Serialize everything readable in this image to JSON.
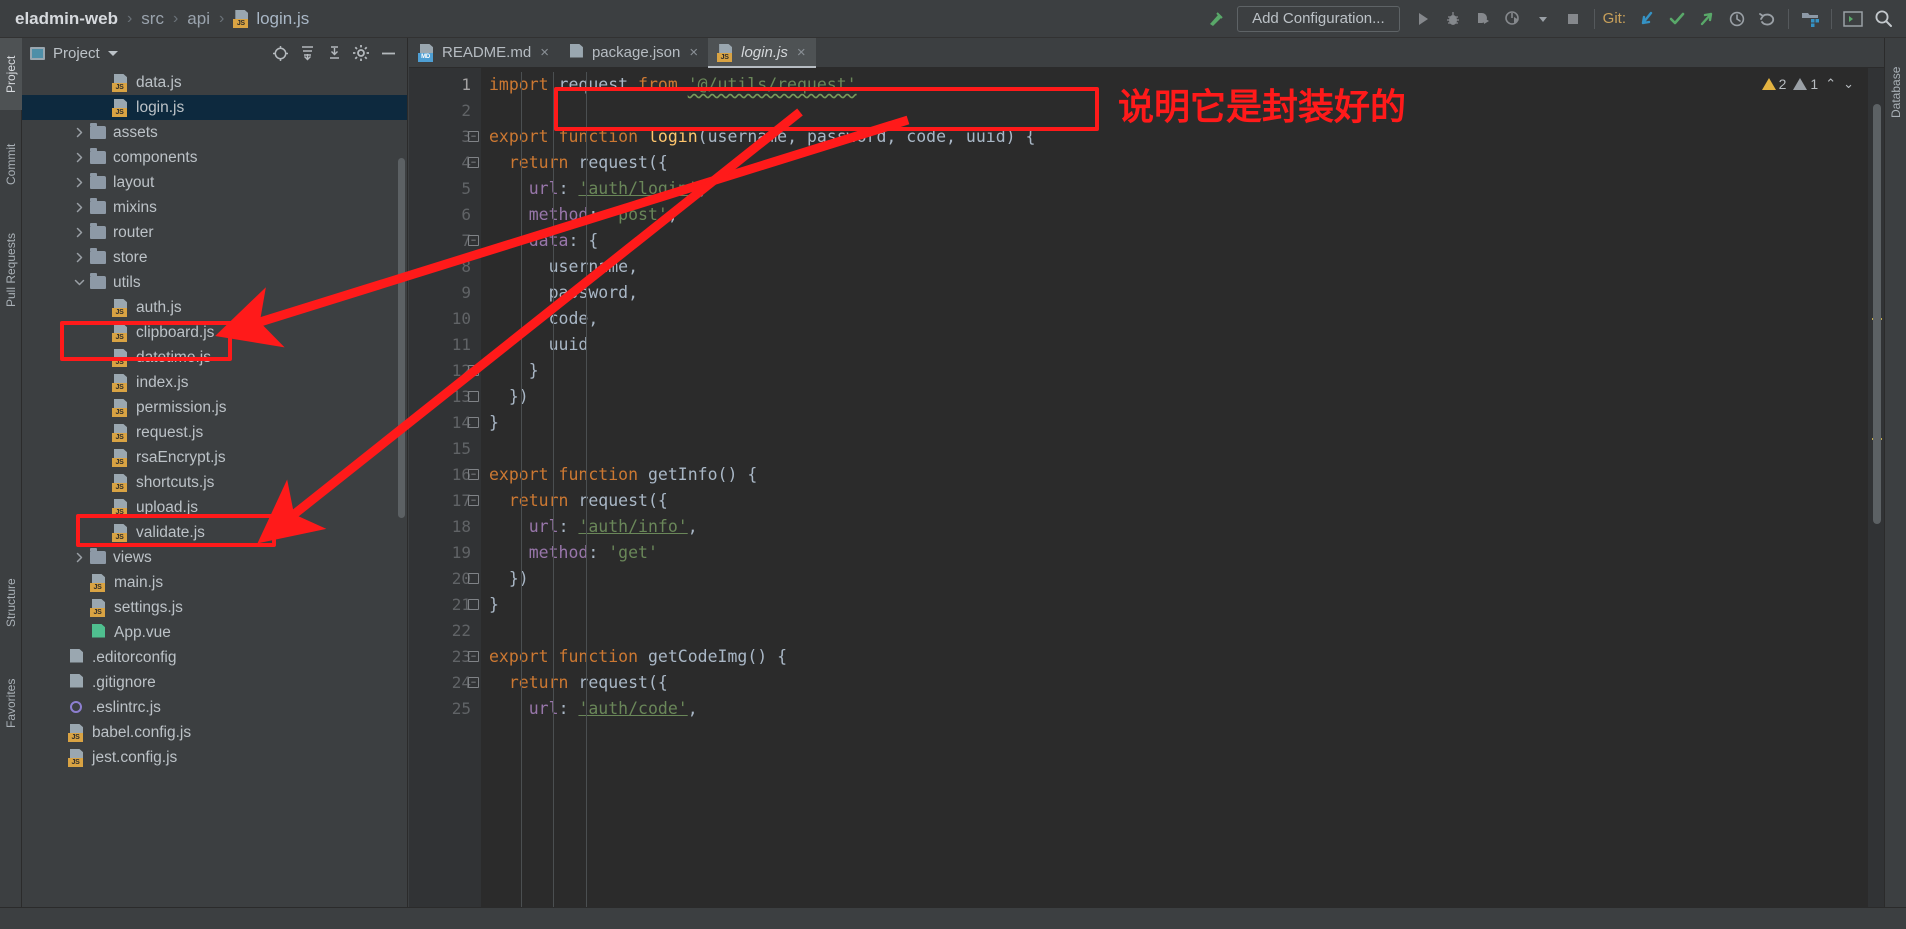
{
  "window": {
    "breadcrumb": [
      {
        "label": "eladmin-web",
        "type": "project"
      },
      {
        "label": "src",
        "type": "dir"
      },
      {
        "label": "api",
        "type": "dir"
      },
      {
        "label": "login.js",
        "type": "file"
      }
    ],
    "separator": "›"
  },
  "toolbar": {
    "add_configuration": "Add Configuration...",
    "git_label": "Git:",
    "icons": {
      "build": "hammer-icon",
      "run": "run-icon",
      "debug": "debug-icon",
      "run_coverage": "run-with-coverage-icon",
      "profile": "profiler-icon",
      "dropdown": "chevron-down-icon",
      "stop": "stop-icon",
      "git_update": "git-update-icon",
      "git_commit": "git-commit-icon",
      "git_push": "git-push-icon",
      "git_history": "git-history-icon",
      "git_rollback": "git-rollback-icon",
      "project_structure": "project-structure-icon",
      "terminal": "terminal-icon",
      "search": "search-icon"
    },
    "colors": {
      "git_update": "#3592c4",
      "git_commit": "#59a869",
      "git_push": "#59a869",
      "hammer": "#59a869"
    }
  },
  "left_tool_strip": [
    {
      "label": "Project",
      "selected": true
    },
    {
      "label": "Commit",
      "selected": false
    },
    {
      "label": "Pull Requests",
      "selected": false
    },
    {
      "label": "Structure",
      "selected": false
    },
    {
      "label": "Favorites",
      "selected": false
    }
  ],
  "right_tool_strip": [
    {
      "label": "Database",
      "selected": false
    }
  ],
  "project_panel": {
    "title": "Project",
    "actions": [
      {
        "name": "select-opened-file-icon"
      },
      {
        "name": "expand-all-icon"
      },
      {
        "name": "collapse-all-icon"
      },
      {
        "name": "settings-gear-icon"
      },
      {
        "name": "hide-icon"
      }
    ],
    "tree": [
      {
        "label": "data.js",
        "indent": 3,
        "icon": "js",
        "arrow": "none",
        "selected": false
      },
      {
        "label": "login.js",
        "indent": 3,
        "icon": "js",
        "arrow": "none",
        "selected": true
      },
      {
        "label": "assets",
        "indent": 2,
        "icon": "folder",
        "arrow": "collapsed",
        "selected": false
      },
      {
        "label": "components",
        "indent": 2,
        "icon": "folder",
        "arrow": "collapsed",
        "selected": false
      },
      {
        "label": "layout",
        "indent": 2,
        "icon": "folder",
        "arrow": "collapsed",
        "selected": false
      },
      {
        "label": "mixins",
        "indent": 2,
        "icon": "folder",
        "arrow": "collapsed",
        "selected": false
      },
      {
        "label": "router",
        "indent": 2,
        "icon": "folder",
        "arrow": "collapsed",
        "selected": false
      },
      {
        "label": "store",
        "indent": 2,
        "icon": "folder",
        "arrow": "collapsed",
        "selected": false
      },
      {
        "label": "utils",
        "indent": 2,
        "icon": "folder",
        "arrow": "expanded",
        "selected": false
      },
      {
        "label": "auth.js",
        "indent": 3,
        "icon": "js",
        "arrow": "none",
        "selected": false
      },
      {
        "label": "clipboard.js",
        "indent": 3,
        "icon": "js",
        "arrow": "none",
        "selected": false
      },
      {
        "label": "datetime.js",
        "indent": 3,
        "icon": "js",
        "arrow": "none",
        "selected": false
      },
      {
        "label": "index.js",
        "indent": 3,
        "icon": "js",
        "arrow": "none",
        "selected": false
      },
      {
        "label": "permission.js",
        "indent": 3,
        "icon": "js",
        "arrow": "none",
        "selected": false
      },
      {
        "label": "request.js",
        "indent": 3,
        "icon": "js",
        "arrow": "none",
        "selected": false
      },
      {
        "label": "rsaEncrypt.js",
        "indent": 3,
        "icon": "js",
        "arrow": "none",
        "selected": false
      },
      {
        "label": "shortcuts.js",
        "indent": 3,
        "icon": "js",
        "arrow": "none",
        "selected": false
      },
      {
        "label": "upload.js",
        "indent": 3,
        "icon": "js",
        "arrow": "none",
        "selected": false
      },
      {
        "label": "validate.js",
        "indent": 3,
        "icon": "js",
        "arrow": "none",
        "selected": false
      },
      {
        "label": "views",
        "indent": 2,
        "icon": "folder",
        "arrow": "collapsed",
        "selected": false
      },
      {
        "label": "main.js",
        "indent": 2,
        "icon": "js",
        "arrow": "none",
        "selected": false
      },
      {
        "label": "settings.js",
        "indent": 2,
        "icon": "js",
        "arrow": "none",
        "selected": false
      },
      {
        "label": "App.vue",
        "indent": 2,
        "icon": "vue",
        "arrow": "none",
        "selected": false
      },
      {
        "label": ".editorconfig",
        "indent": 1,
        "icon": "cfg",
        "arrow": "none",
        "selected": false
      },
      {
        "label": ".gitignore",
        "indent": 1,
        "icon": "git",
        "arrow": "none",
        "selected": false
      },
      {
        "label": ".eslintrc.js",
        "indent": 1,
        "icon": "eslint",
        "arrow": "none",
        "selected": false
      },
      {
        "label": "babel.config.js",
        "indent": 1,
        "icon": "js",
        "arrow": "none",
        "selected": false
      },
      {
        "label": "jest.config.js",
        "indent": 1,
        "icon": "js",
        "arrow": "none",
        "selected": false
      }
    ]
  },
  "editor": {
    "tabs": [
      {
        "label": "README.md",
        "icon": "md",
        "active": false,
        "close": "×"
      },
      {
        "label": "package.json",
        "icon": "json",
        "active": false,
        "close": "×"
      },
      {
        "label": "login.js",
        "icon": "js",
        "active": true,
        "close": "×"
      }
    ],
    "inspection": {
      "warning_count": "2",
      "weak_warning_count": "1",
      "up_chevron": "⌃",
      "down_chevron": "⌄"
    },
    "lines": [
      {
        "n": "1",
        "fold": "none",
        "tokens": [
          {
            "t": "import",
            "c": "kw"
          },
          {
            "t": " ",
            "c": "pun"
          },
          {
            "t": "request",
            "c": "idn"
          },
          {
            "t": " ",
            "c": "pun"
          },
          {
            "t": "from",
            "c": "kw"
          },
          {
            "t": " ",
            "c": "pun"
          },
          {
            "t": "'@/utils/request'",
            "c": "wavy-str"
          }
        ]
      },
      {
        "n": "2",
        "fold": "none",
        "tokens": []
      },
      {
        "n": "3",
        "fold": "open",
        "tokens": [
          {
            "t": "export",
            "c": "kw"
          },
          {
            "t": " ",
            "c": "pun"
          },
          {
            "t": "function",
            "c": "kw"
          },
          {
            "t": " ",
            "c": "pun"
          },
          {
            "t": "login",
            "c": "fn"
          },
          {
            "t": "(",
            "c": "pun"
          },
          {
            "t": "username",
            "c": "idn"
          },
          {
            "t": ", ",
            "c": "pun"
          },
          {
            "t": "password",
            "c": "idn"
          },
          {
            "t": ", ",
            "c": "pun"
          },
          {
            "t": "code",
            "c": "idn"
          },
          {
            "t": ", ",
            "c": "pun"
          },
          {
            "t": "uuid",
            "c": "idn"
          },
          {
            "t": ") {",
            "c": "pun"
          }
        ]
      },
      {
        "n": "4",
        "fold": "open",
        "tokens": [
          {
            "t": "  ",
            "c": "pun"
          },
          {
            "t": "return",
            "c": "kw"
          },
          {
            "t": " ",
            "c": "pun"
          },
          {
            "t": "request",
            "c": "idn"
          },
          {
            "t": "({",
            "c": "pun"
          }
        ]
      },
      {
        "n": "5",
        "fold": "none",
        "tokens": [
          {
            "t": "    ",
            "c": "pun"
          },
          {
            "t": "url",
            "c": "prop"
          },
          {
            "t": ": ",
            "c": "pun"
          },
          {
            "t": "'auth/login'",
            "c": "str-u"
          },
          {
            "t": ",",
            "c": "pun"
          }
        ]
      },
      {
        "n": "6",
        "fold": "none",
        "tokens": [
          {
            "t": "    ",
            "c": "pun"
          },
          {
            "t": "method",
            "c": "prop"
          },
          {
            "t": ": ",
            "c": "pun"
          },
          {
            "t": "'post'",
            "c": "str"
          },
          {
            "t": ",",
            "c": "pun"
          }
        ]
      },
      {
        "n": "7",
        "fold": "open",
        "tokens": [
          {
            "t": "    ",
            "c": "pun"
          },
          {
            "t": "data",
            "c": "prop"
          },
          {
            "t": ": {",
            "c": "pun"
          }
        ]
      },
      {
        "n": "8",
        "fold": "none",
        "tokens": [
          {
            "t": "      ",
            "c": "pun"
          },
          {
            "t": "username",
            "c": "idn"
          },
          {
            "t": ",",
            "c": "pun"
          }
        ]
      },
      {
        "n": "9",
        "fold": "none",
        "tokens": [
          {
            "t": "      ",
            "c": "pun"
          },
          {
            "t": "password",
            "c": "idn"
          },
          {
            "t": ",",
            "c": "pun"
          }
        ]
      },
      {
        "n": "10",
        "fold": "none",
        "tokens": [
          {
            "t": "      ",
            "c": "pun"
          },
          {
            "t": "code",
            "c": "idn"
          },
          {
            "t": ",",
            "c": "pun"
          }
        ]
      },
      {
        "n": "11",
        "fold": "none",
        "tokens": [
          {
            "t": "      ",
            "c": "pun"
          },
          {
            "t": "uuid",
            "c": "idn"
          }
        ]
      },
      {
        "n": "12",
        "fold": "close",
        "tokens": [
          {
            "t": "    }",
            "c": "pun"
          }
        ]
      },
      {
        "n": "13",
        "fold": "close",
        "tokens": [
          {
            "t": "  })",
            "c": "pun"
          }
        ]
      },
      {
        "n": "14",
        "fold": "close",
        "tokens": [
          {
            "t": "}",
            "c": "pun"
          }
        ]
      },
      {
        "n": "15",
        "fold": "none",
        "tokens": []
      },
      {
        "n": "16",
        "fold": "open",
        "tokens": [
          {
            "t": "export",
            "c": "kw"
          },
          {
            "t": " ",
            "c": "pun"
          },
          {
            "t": "function",
            "c": "kw"
          },
          {
            "t": " ",
            "c": "pun"
          },
          {
            "t": "getInfo",
            "c": "idn"
          },
          {
            "t": "() {",
            "c": "pun"
          }
        ]
      },
      {
        "n": "17",
        "fold": "open",
        "tokens": [
          {
            "t": "  ",
            "c": "pun"
          },
          {
            "t": "return",
            "c": "kw"
          },
          {
            "t": " ",
            "c": "pun"
          },
          {
            "t": "request",
            "c": "idn"
          },
          {
            "t": "({",
            "c": "pun"
          }
        ]
      },
      {
        "n": "18",
        "fold": "none",
        "tokens": [
          {
            "t": "    ",
            "c": "pun"
          },
          {
            "t": "url",
            "c": "prop"
          },
          {
            "t": ": ",
            "c": "pun"
          },
          {
            "t": "'auth/info'",
            "c": "str-u"
          },
          {
            "t": ",",
            "c": "pun"
          }
        ]
      },
      {
        "n": "19",
        "fold": "none",
        "tokens": [
          {
            "t": "    ",
            "c": "pun"
          },
          {
            "t": "method",
            "c": "prop"
          },
          {
            "t": ": ",
            "c": "pun"
          },
          {
            "t": "'get'",
            "c": "str"
          }
        ]
      },
      {
        "n": "20",
        "fold": "close",
        "tokens": [
          {
            "t": "  })",
            "c": "pun"
          }
        ]
      },
      {
        "n": "21",
        "fold": "close",
        "tokens": [
          {
            "t": "}",
            "c": "pun"
          }
        ]
      },
      {
        "n": "22",
        "fold": "none",
        "tokens": []
      },
      {
        "n": "23",
        "fold": "open",
        "tokens": [
          {
            "t": "export",
            "c": "kw"
          },
          {
            "t": " ",
            "c": "pun"
          },
          {
            "t": "function",
            "c": "kw"
          },
          {
            "t": " ",
            "c": "pun"
          },
          {
            "t": "getCodeImg",
            "c": "idn"
          },
          {
            "t": "() {",
            "c": "pun"
          }
        ]
      },
      {
        "n": "24",
        "fold": "open",
        "tokens": [
          {
            "t": "  ",
            "c": "pun"
          },
          {
            "t": "return",
            "c": "kw"
          },
          {
            "t": " ",
            "c": "pun"
          },
          {
            "t": "request",
            "c": "idn"
          },
          {
            "t": "({",
            "c": "pun"
          }
        ]
      },
      {
        "n": "25",
        "fold": "none",
        "tokens": [
          {
            "t": "    ",
            "c": "pun"
          },
          {
            "t": "url",
            "c": "prop"
          },
          {
            "t": ": ",
            "c": "pun"
          },
          {
            "t": "'auth/code'",
            "c": "str-u"
          },
          {
            "t": ",",
            "c": "pun"
          }
        ]
      }
    ]
  },
  "annotations": {
    "note_text": "说明它是封装好的",
    "color": "#ff1a1a",
    "boxes": [
      {
        "name": "import-statement-highlight"
      },
      {
        "name": "utils-folder-highlight"
      },
      {
        "name": "request-file-highlight"
      }
    ],
    "arrows": [
      {
        "name": "arrow-to-utils-folder"
      },
      {
        "name": "arrow-to-request-file"
      }
    ]
  }
}
